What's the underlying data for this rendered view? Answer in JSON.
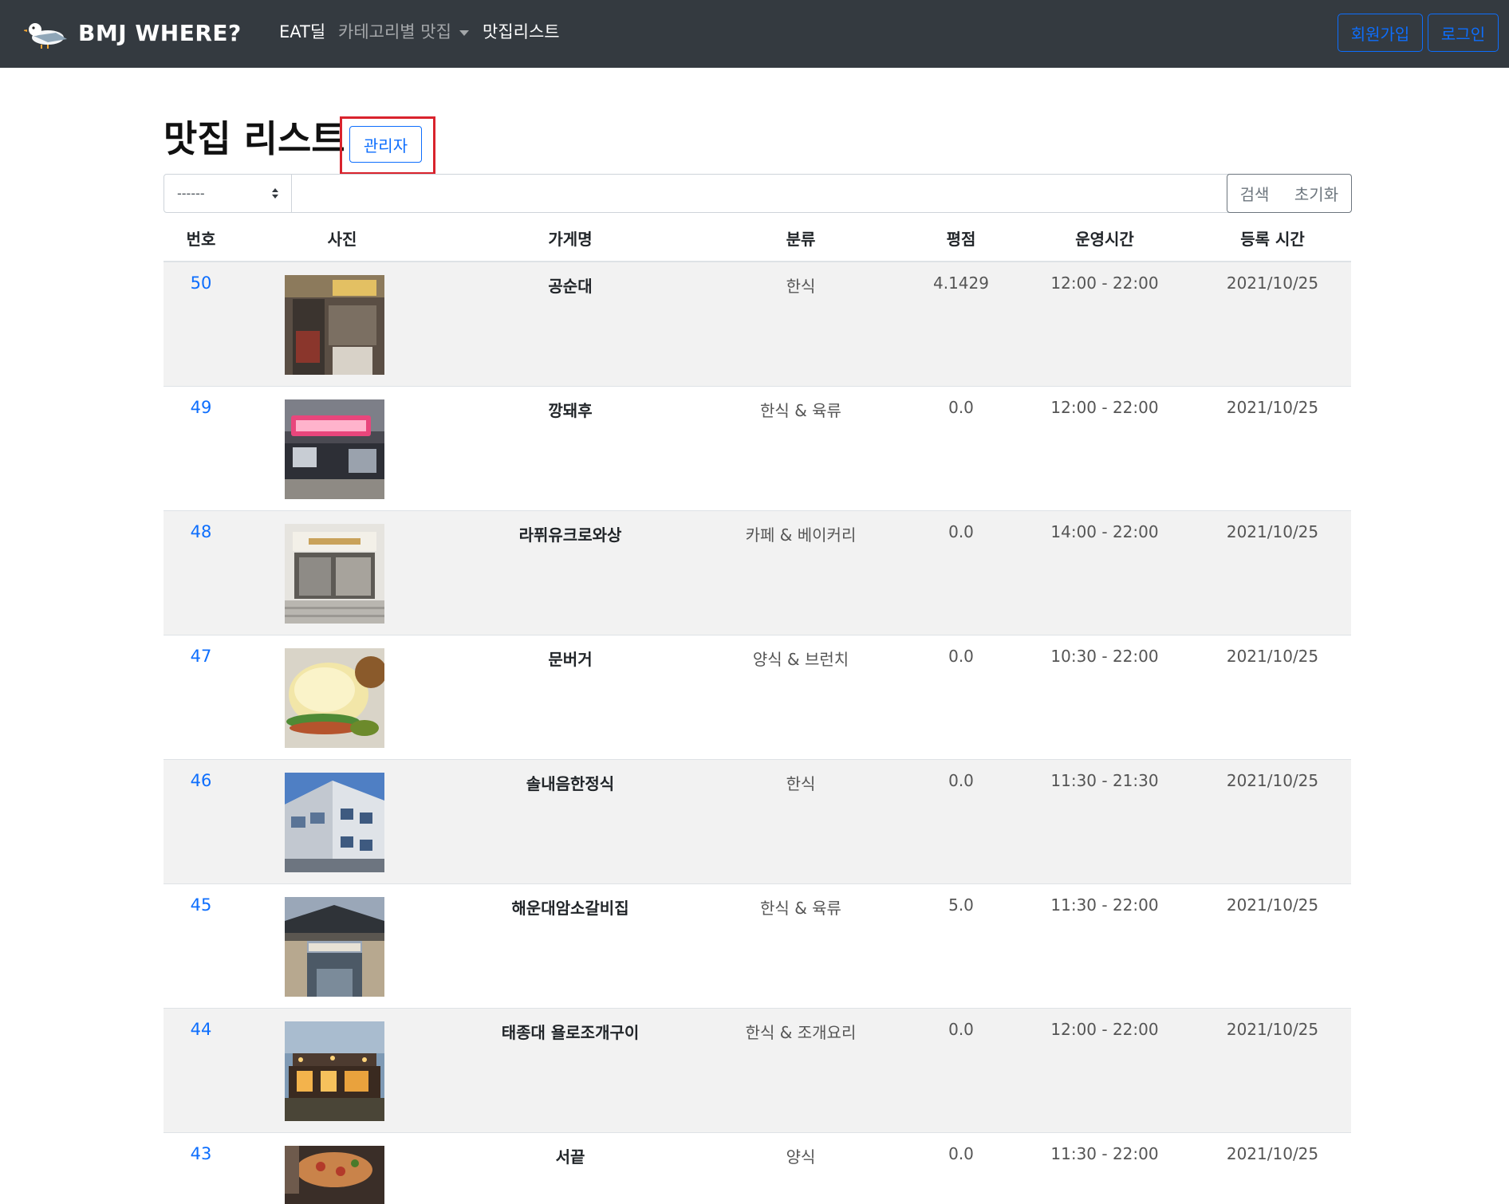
{
  "navbar": {
    "brand": "BMJ WHERE?",
    "logo_icon": "seagull-logo-icon",
    "links": {
      "eat_deal": "EAT딜",
      "category": "카테고리별 맛집",
      "restaurant_list": "맛집리스트"
    },
    "signup_label": "회원가입",
    "login_label": "로그인",
    "bg_color": "#343a40",
    "accent_color": "#0d6efd"
  },
  "page": {
    "title": "맛집 리스트",
    "admin_label": "관리자",
    "highlight_color": "#d9232d"
  },
  "search": {
    "select_value": "------",
    "input_value": "",
    "search_label": "검색",
    "reset_label": "초기화"
  },
  "table": {
    "headers": {
      "no": "번호",
      "photo": "사진",
      "name": "가게명",
      "category": "분류",
      "rating": "평점",
      "hours": "운영시간",
      "registered": "등록 시간"
    },
    "rows": [
      {
        "no": "50",
        "name": "공순대",
        "category": "한식",
        "rating": "4.1429",
        "hours": "12:00 - 22:00",
        "date": "2021/10/25",
        "photo": "storefront-photo"
      },
      {
        "no": "49",
        "name": "깡돼후",
        "category": "한식 & 육류",
        "rating": "0.0",
        "hours": "12:00 - 22:00",
        "date": "2021/10/25",
        "photo": "neon-sign-photo"
      },
      {
        "no": "48",
        "name": "라퓌유크로와상",
        "category": "카페 & 베이커리",
        "rating": "0.0",
        "hours": "14:00 - 22:00",
        "date": "2021/10/25",
        "photo": "bakery-photo"
      },
      {
        "no": "47",
        "name": "문버거",
        "category": "양식 & 브런치",
        "rating": "0.0",
        "hours": "10:30 - 22:00",
        "date": "2021/10/25",
        "photo": "burger-photo"
      },
      {
        "no": "46",
        "name": "솔내음한정식",
        "category": "한식",
        "rating": "0.0",
        "hours": "11:30 - 21:30",
        "date": "2021/10/25",
        "photo": "building-photo"
      },
      {
        "no": "45",
        "name": "해운대암소갈비집",
        "category": "한식 & 육류",
        "rating": "5.0",
        "hours": "11:30 - 22:00",
        "date": "2021/10/25",
        "photo": "hanok-gate-photo"
      },
      {
        "no": "44",
        "name": "태종대 욜로조개구이",
        "category": "한식 & 조개요리",
        "rating": "0.0",
        "hours": "12:00 - 22:00",
        "date": "2021/10/25",
        "photo": "night-terrace-photo"
      },
      {
        "no": "43",
        "name": "서끝",
        "category": "양식",
        "rating": "0.0",
        "hours": "11:30 - 22:00",
        "date": "2021/10/25",
        "photo": "pizza-photo"
      }
    ]
  }
}
